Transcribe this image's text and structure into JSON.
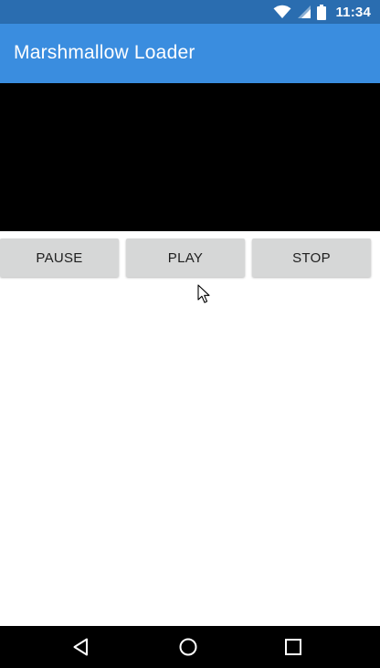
{
  "status_bar": {
    "time": "11:34",
    "icons": [
      "wifi-icon",
      "signal-icon",
      "battery-icon"
    ],
    "color": "#2a6db0"
  },
  "app_bar": {
    "title": "Marshmallow Loader",
    "color": "#3a8ddf"
  },
  "controls": {
    "pause_label": "PAUSE",
    "play_label": "PLAY",
    "stop_label": "STOP"
  },
  "nav_bar": {
    "icons": [
      "back-icon",
      "home-icon",
      "recents-icon"
    ]
  }
}
